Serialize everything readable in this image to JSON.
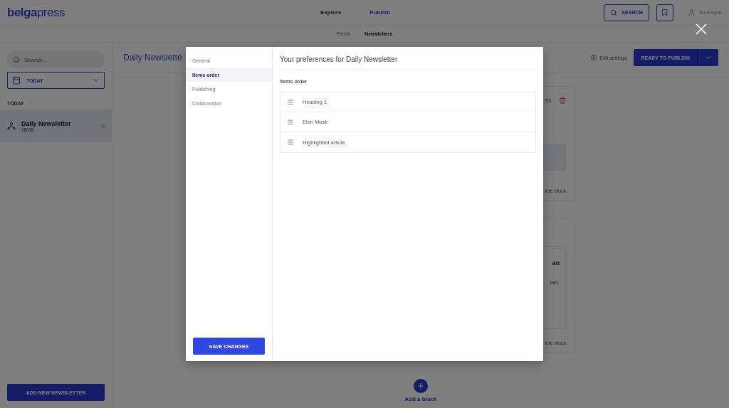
{
  "header": {
    "logo": "**belga**press",
    "nav": [
      {
        "label": "Explore",
        "selected": false
      },
      {
        "label": "Publish",
        "selected": true
      }
    ],
    "search_button": "SEARCH",
    "user": "Example"
  },
  "subnav": [
    {
      "label": "Feeds",
      "selected": false
    },
    {
      "label": "Newsletters",
      "selected": true
    }
  ],
  "sidebar": {
    "search": {
      "placeholder": "Search..."
    },
    "date_filter": "TODAY",
    "section": "TODAY",
    "items": [
      {
        "title": "Daily Newsletter",
        "time": "18:00",
        "selected": true
      }
    ],
    "add_button": "ADD NEW NEWSLETTER"
  },
  "main": {
    "title": "Daily Newslette",
    "edit_settings": "Edit settings",
    "publish_button": "READY TO PUBLISH",
    "blocks": [
      {
        "time": ":51",
        "delete": "lete block"
      },
      {
        "heading": "an",
        "text": "zier.",
        "delete": "lete block"
      }
    ],
    "add_block": "Add a block"
  },
  "modal": {
    "nav": [
      {
        "label": "General",
        "selected": false
      },
      {
        "label": "Items order",
        "selected": true
      },
      {
        "label": "Publishing",
        "selected": false
      },
      {
        "label": "Collaboration",
        "selected": false
      }
    ],
    "title": "Your preferences for Daily Newsletter",
    "section": "Items order",
    "items": [
      "Heading 1",
      "Elon Musk",
      "Highlighted article"
    ],
    "save_button": "SAVE CHANGES"
  }
}
